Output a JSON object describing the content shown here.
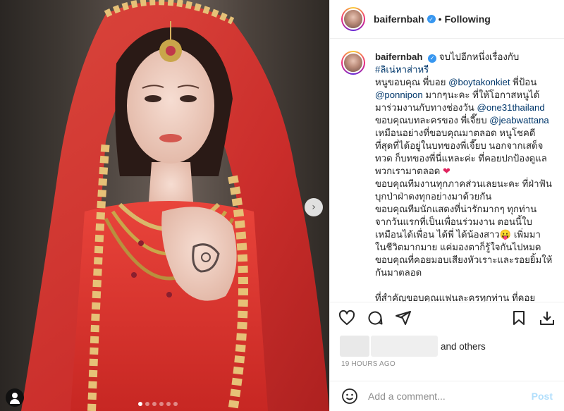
{
  "post": {
    "username": "baifernbah",
    "separator": "•",
    "follow_state": "Following"
  },
  "caption": {
    "username": "baifernbah",
    "lines": [
      {
        "text": "จบไปอีกหนึ่งเรื่องกับ",
        "type": "text"
      },
      {
        "text": "#ลิเน่หาส่าหรี",
        "type": "mention"
      }
    ],
    "body": [
      [
        "หนูขอบคุณ พี่บอย ",
        {
          "m": "@boytakonkiet"
        },
        " พี่ป้อน"
      ],
      [
        {
          "m": "@ponnipon"
        },
        " มากๆนะคะ ที่ให้โอกาสหนูได้"
      ],
      [
        "มาร่วมงานกับทางช่องวัน ",
        {
          "m": "@one31thailand"
        }
      ],
      [
        "ขอบคุณบทละครของ พี่เจี๊ยบ ",
        {
          "m": "@jeabwattana"
        }
      ],
      [
        "เหมือนอย่างที่ขอบคุณมาตลอด หนูโชคดี"
      ],
      [
        "ที่สุดที่ได้อยู่ในบทของพี่เจี๊ยบ นอกจากเสด็จ"
      ],
      [
        "ทวด ก็บทของพี่นี่แหละค่ะ ที่คอยปกป้องดูแล"
      ],
      [
        "พวกเรามาตลอด ",
        {
          "h": "❤"
        }
      ],
      [
        "ขอบคุณทีมงานทุกภาคส่วนเลยนะคะ ที่ฝ่าฟัน"
      ],
      [
        "บุกป่าฝ่าดงทุกอย่างมาด้วยกัน"
      ],
      [
        "ขอบคุณทีมนักแสดงที่น่ารักมากๆ ทุกท่าน"
      ],
      [
        "จากวันแรกที่เป็นเพื่อนร่วมงาน ตอนนี้ใบ"
      ],
      [
        "เหมือนได้เพื่อน ได้พี่ ได้น้องสาว😛 เพิ่มมา"
      ],
      [
        "ในชีวิตมากมาย แค่มองตาก็รู้ใจกันไปหมด"
      ],
      [
        "ขอบคุณที่คอยมอบเสียงหัวเราะและรอยยิ้มให้"
      ],
      [
        "กันมาตลอด"
      ],
      [
        ""
      ],
      [
        "ที่สำคัญขอบคุณแฟนละครทุกท่าน ที่คอย"
      ]
    ]
  },
  "likes": {
    "suffix": "and others"
  },
  "timestamp": "19 HOURS AGO",
  "comment": {
    "placeholder": "Add a comment...",
    "post_label": "Post"
  },
  "carousel": {
    "count": 6,
    "active_index": 0
  },
  "colors": {
    "accent": "#3897f0",
    "mention": "#00376b",
    "heart": "#e0245e",
    "post_disabled": "#b2dffc"
  },
  "icons": [
    "heart-icon",
    "comment-icon",
    "share-icon",
    "save-icon",
    "download-icon",
    "emoji-icon",
    "chevron-right-icon",
    "user-tag-icon",
    "verified-icon"
  ]
}
